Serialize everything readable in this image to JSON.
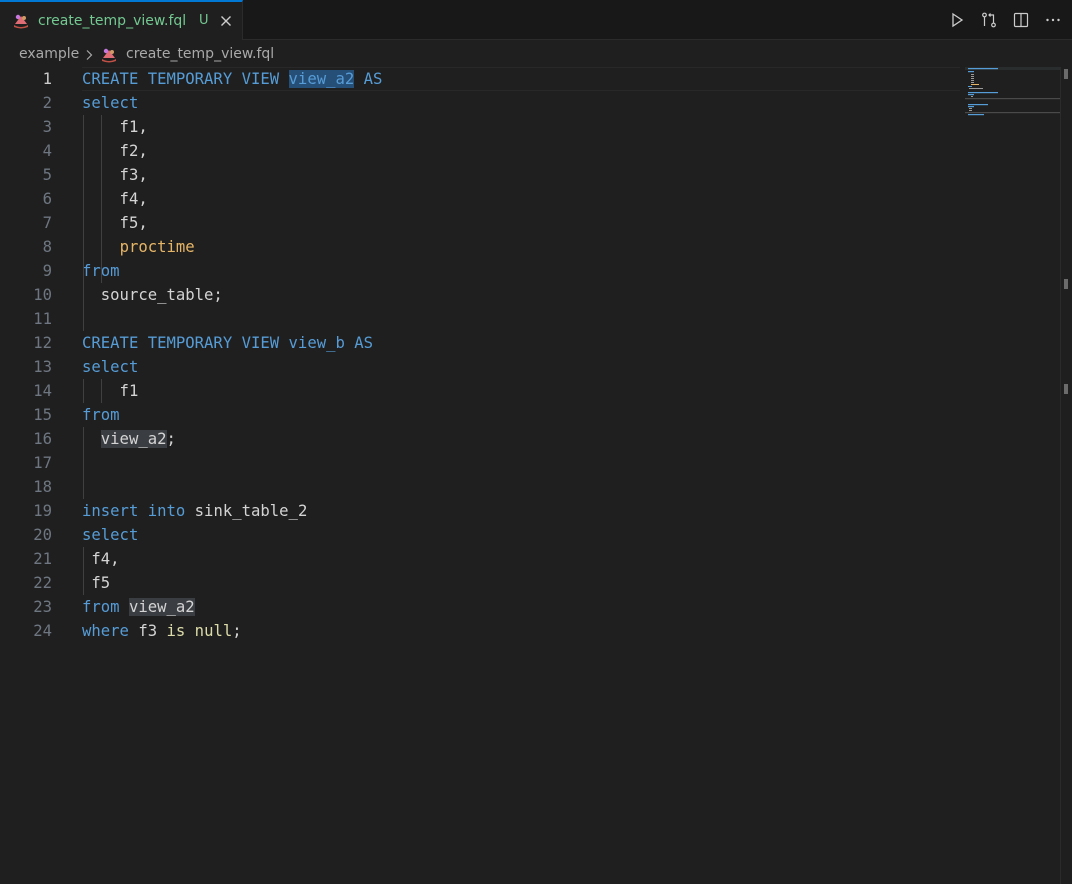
{
  "tab": {
    "filename": "create_temp_view.fql",
    "status_badge": "U"
  },
  "breadcrumb": {
    "folder": "example",
    "file": "create_temp_view.fql"
  },
  "icons": {
    "file": "fql-file-icon",
    "close": "close-icon",
    "run": "run-icon",
    "compare": "compare-changes-icon",
    "split": "split-editor-icon",
    "more": "more-actions-icon",
    "chevron": "chevron-right-icon"
  },
  "colors": {
    "accent": "#0078d4",
    "untracked": "#73c991",
    "keyword": "#569cd6",
    "identifier": "#d4d4d4",
    "function": "#e5b567",
    "literal": "#dcdcaa"
  },
  "editor": {
    "active_line": 1,
    "lines": [
      {
        "num": "1",
        "tokens": [
          [
            "CREATE TEMPORARY VIEW ",
            "kw"
          ],
          [
            "view_a2",
            "kw hlsel"
          ],
          [
            " AS",
            "kw"
          ]
        ]
      },
      {
        "num": "2",
        "tokens": [
          [
            "select",
            "kw"
          ]
        ]
      },
      {
        "num": "3",
        "tokens": [
          [
            "    f1,",
            "plain"
          ]
        ]
      },
      {
        "num": "4",
        "tokens": [
          [
            "    f2,",
            "plain"
          ]
        ]
      },
      {
        "num": "5",
        "tokens": [
          [
            "    f3,",
            "plain"
          ]
        ]
      },
      {
        "num": "6",
        "tokens": [
          [
            "    f4,",
            "plain"
          ]
        ]
      },
      {
        "num": "7",
        "tokens": [
          [
            "    f5,",
            "plain"
          ]
        ]
      },
      {
        "num": "8",
        "tokens": [
          [
            "    ",
            "plain"
          ],
          [
            "proctime",
            "fn"
          ]
        ]
      },
      {
        "num": "9",
        "tokens": [
          [
            "from",
            "kw"
          ]
        ]
      },
      {
        "num": "10",
        "tokens": [
          [
            "  source_table;",
            "plain"
          ]
        ]
      },
      {
        "num": "11",
        "tokens": []
      },
      {
        "num": "12",
        "tokens": [
          [
            "CREATE TEMPORARY VIEW view_b AS",
            "kw"
          ]
        ]
      },
      {
        "num": "13",
        "tokens": [
          [
            "select",
            "kw"
          ]
        ]
      },
      {
        "num": "14",
        "tokens": [
          [
            "    f1",
            "plain"
          ]
        ]
      },
      {
        "num": "15",
        "tokens": [
          [
            "from",
            "kw"
          ]
        ]
      },
      {
        "num": "16",
        "tokens": [
          [
            "  ",
            "plain"
          ],
          [
            "view_a2",
            "plain hl"
          ],
          [
            ";",
            "plain"
          ]
        ]
      },
      {
        "num": "17",
        "tokens": []
      },
      {
        "num": "18",
        "tokens": []
      },
      {
        "num": "19",
        "tokens": [
          [
            "insert into ",
            "kw"
          ],
          [
            "sink_table_2",
            "plain"
          ]
        ]
      },
      {
        "num": "20",
        "tokens": [
          [
            "select",
            "kw"
          ]
        ]
      },
      {
        "num": "21",
        "tokens": [
          [
            " f4,",
            "plain"
          ]
        ]
      },
      {
        "num": "22",
        "tokens": [
          [
            " f5",
            "plain"
          ]
        ]
      },
      {
        "num": "23",
        "tokens": [
          [
            "from ",
            "kw"
          ],
          [
            "view_a2",
            "plain hl"
          ]
        ]
      },
      {
        "num": "24",
        "tokens": [
          [
            "where ",
            "kw"
          ],
          [
            "f3 ",
            "plain"
          ],
          [
            "is null",
            "lit"
          ],
          [
            ";",
            "plain"
          ]
        ]
      }
    ]
  }
}
